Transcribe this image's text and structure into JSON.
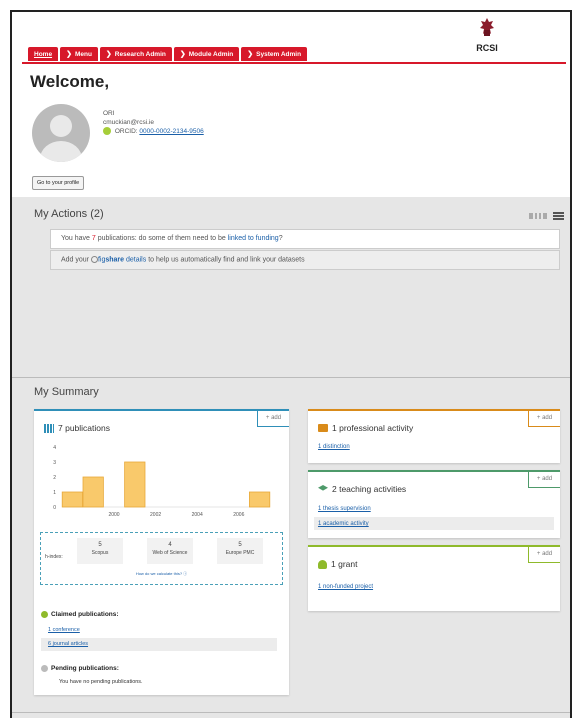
{
  "nav": {
    "items": [
      {
        "label": "Home",
        "active": true
      },
      {
        "label": "Menu",
        "active": false
      },
      {
        "label": "Research Admin",
        "active": false
      },
      {
        "label": "Module Admin",
        "active": false
      },
      {
        "label": "System Admin",
        "active": false
      }
    ]
  },
  "logo": {
    "text": "RCSI"
  },
  "profile": {
    "welcome": "Welcome,",
    "org": "ORI",
    "email": "cmuckian@rcsi.ie",
    "orcid_label": "ORCID:",
    "orcid_id": "0000-0002-2134-9506",
    "profile_button": "Go to your profile"
  },
  "actions": {
    "title": "My Actions (2)",
    "item1": {
      "prefix": "You have ",
      "count": "7",
      "middle": " publications: do some of them need to be ",
      "link": "linked to funding",
      "suffix": "?"
    },
    "item2": {
      "prefix": "Add your ",
      "brand_pre": "fig",
      "brand_bold": "share",
      "link": " details",
      "suffix": " to help us automatically find and link your datasets"
    }
  },
  "summary": {
    "title": "My Summary",
    "add_label": "+ add",
    "publications": {
      "title": "7 publications",
      "metric_label": "h-index:",
      "metrics": [
        {
          "value": "5",
          "source": "Scopus"
        },
        {
          "value": "4",
          "source": "Web of Science"
        },
        {
          "value": "5",
          "source": "Europe PMC"
        }
      ],
      "metrics_note": "How do we calculate this? ⓘ",
      "claimed_title": "Claimed publications:",
      "claimed_items": [
        "1 conference",
        "6 journal articles"
      ],
      "pending_title": "Pending publications:",
      "pending_note": "You have no pending publications."
    },
    "professional": {
      "title": "1 professional activity",
      "links": [
        "1 distinction"
      ],
      "color": "#d98b1a"
    },
    "teaching": {
      "title": "2 teaching activities",
      "links": [
        "1 thesis supervision",
        "1 academic activity"
      ],
      "color": "#4e9a6a"
    },
    "grant": {
      "title": "1 grant",
      "links": [
        "1 non-funded project"
      ],
      "color": "#8fba2b"
    }
  },
  "chart_data": {
    "type": "bar",
    "x": [
      1998,
      1999,
      2000,
      2001,
      2002,
      2003,
      2004,
      2005,
      2006,
      2007
    ],
    "values": [
      1,
      2,
      0,
      3,
      0,
      0,
      0,
      0,
      0,
      1
    ],
    "x_tick_labels": [
      "2000",
      "2002",
      "2004",
      "2006"
    ],
    "y_tick_labels": [
      "0",
      "1",
      "2",
      "3",
      "4"
    ],
    "ylim": [
      0,
      4
    ],
    "bar_color": "#f9c96b",
    "bar_stroke": "#e8a93a",
    "title": "",
    "xlabel": "",
    "ylabel": ""
  }
}
